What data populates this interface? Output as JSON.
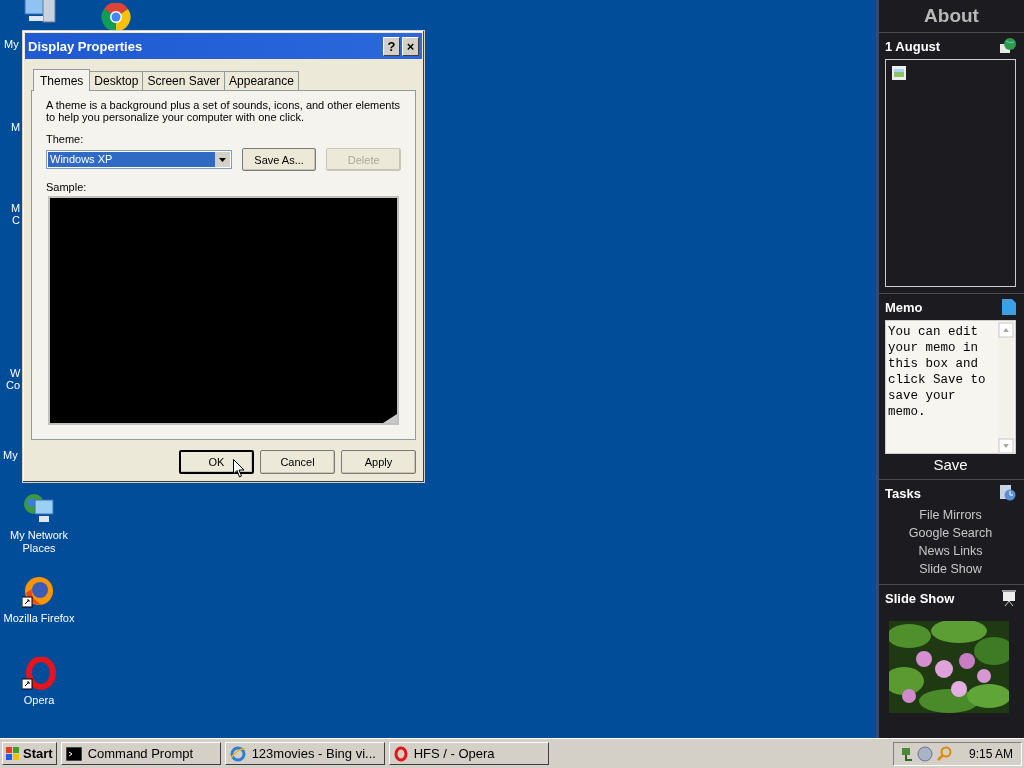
{
  "desktop": {
    "label_fragments": [
      {
        "text": "My"
      },
      {
        "text": "M"
      },
      {
        "text": "M"
      },
      {
        "text": "C"
      },
      {
        "text": "W"
      },
      {
        "text": "Co"
      },
      {
        "text": "My"
      }
    ],
    "icons": [
      {
        "kind": "computer"
      },
      {
        "kind": "chrome"
      },
      {
        "kind": "network",
        "label": "My Network Places"
      },
      {
        "kind": "firefox",
        "label": "Mozilla Firefox"
      },
      {
        "kind": "opera",
        "label": "Opera"
      }
    ]
  },
  "dialog": {
    "title": "Display Properties",
    "title_buttons": [
      "?",
      "×"
    ],
    "tabs": [
      {
        "label": "Themes",
        "selected": true
      },
      {
        "label": "Desktop",
        "selected": false
      },
      {
        "label": "Screen Saver",
        "selected": false
      },
      {
        "label": "Appearance",
        "selected": false
      }
    ],
    "description": "A theme is a background plus a set of sounds, icons, and other elements to help you personalize your computer with one click.",
    "theme_label": "Theme:",
    "theme_value": "Windows XP",
    "theme_buttons": [
      {
        "label": "Save As...",
        "disabled": false
      },
      {
        "label": "Delete",
        "disabled": true
      }
    ],
    "sample_label": "Sample:",
    "buttons": [
      {
        "label": "OK",
        "default": true
      },
      {
        "label": "Cancel",
        "default": false
      },
      {
        "label": "Apply",
        "default": false
      }
    ]
  },
  "sidebar": {
    "header": "About",
    "calendar": {
      "title": "1 August"
    },
    "memo": {
      "title": "Memo",
      "text": "You can edit your memo in this box and click Save to save your memo.",
      "save": "Save"
    },
    "tasks": {
      "title": "Tasks",
      "links": [
        "File Mirrors",
        "Google Search",
        "News Links",
        "Slide Show"
      ]
    },
    "slideshow": {
      "title": "Slide Show"
    }
  },
  "taskbar": {
    "start": "Start",
    "tasks": [
      {
        "kind": "cmd",
        "label": "Command Prompt"
      },
      {
        "kind": "ie",
        "label": "123movies - Bing vi..."
      },
      {
        "kind": "opera",
        "label": "HFS / - Opera"
      }
    ],
    "clock": "9:15 AM"
  }
}
